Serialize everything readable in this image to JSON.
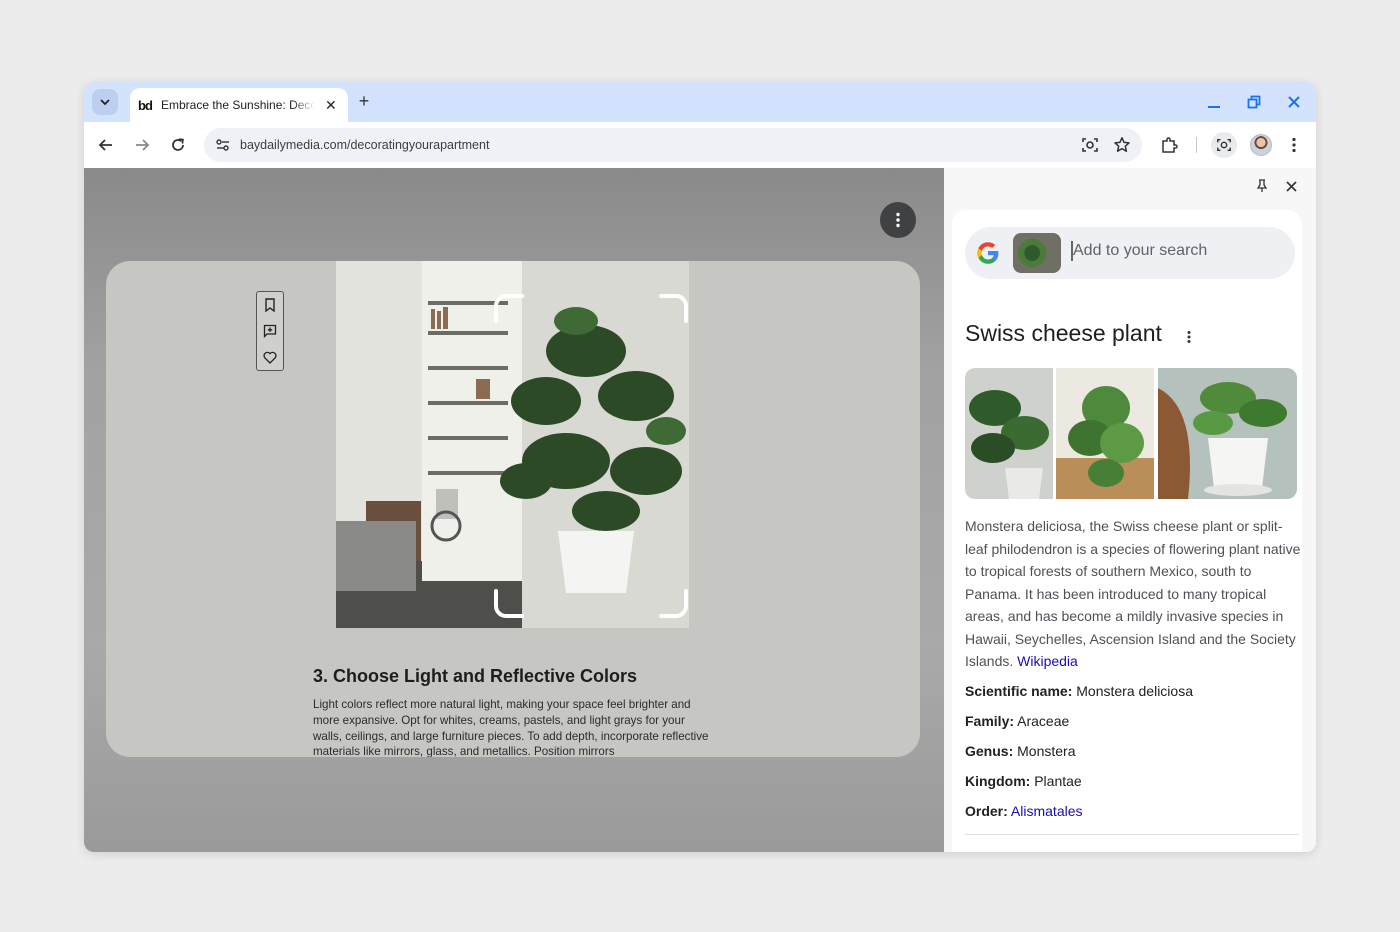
{
  "browser": {
    "tab": {
      "favicon": "bd",
      "title": "Embrace the Sunshine: Decorating your apartment"
    },
    "new_tab": "+",
    "url": "baydailymedia.com/decoratingyourapartment"
  },
  "article": {
    "heading": "3. Choose Light and Reflective Colors",
    "body": "Light colors reflect more natural light, making your space feel brighter and more expansive. Opt for whites, creams, pastels, and light grays for your walls, ceilings, and large furniture pieces. To add depth, incorporate reflective materials like mirrors, glass, and metallics. Position mirrors"
  },
  "side_panel": {
    "search_placeholder": "Add to your search",
    "result": {
      "title": "Swiss cheese plant",
      "description": "Monstera deliciosa, the Swiss cheese plant or split-leaf philodendron is a species of flowering plant native to tropical forests of southern Mexico, south to Panama. It has been introduced to many tropical areas, and has become a mildly invasive species in Hawaii, Seychelles, Ascension Island and the Society Islands.",
      "source_link": "Wikipedia",
      "facts": [
        {
          "label": "Scientific name:",
          "value": "Monstera deliciosa"
        },
        {
          "label": "Family:",
          "value": "Araceae"
        },
        {
          "label": "Genus:",
          "value": "Monstera"
        },
        {
          "label": "Kingdom:",
          "value": "Plantae"
        },
        {
          "label": "Order:",
          "value": "Alismatales"
        }
      ]
    }
  },
  "colors": {
    "tabstrip": "#d3e3fd",
    "accent_blue": "#1a73e8",
    "link": "#1a0dab"
  },
  "icons": [
    "tab-search-icon",
    "close-icon",
    "minimize-icon",
    "restore-icon",
    "back-icon",
    "forward-icon",
    "reload-icon",
    "site-settings-icon",
    "lens-icon",
    "bookmark-star-icon",
    "extensions-icon",
    "more-vert-icon",
    "pin-icon",
    "google-logo",
    "bookmark-icon",
    "add-comment-icon",
    "heart-icon"
  ]
}
